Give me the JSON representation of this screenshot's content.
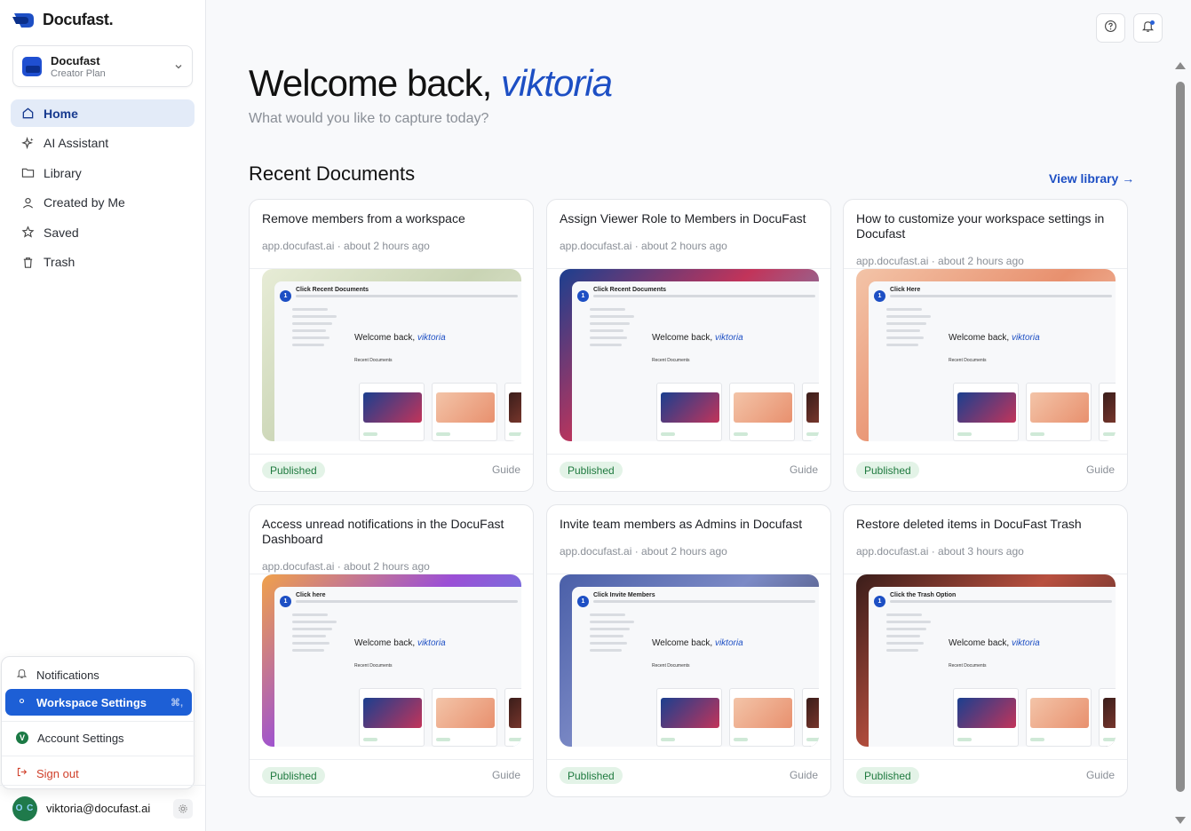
{
  "brand": {
    "name": "Docufast."
  },
  "workspace": {
    "name": "Docufast",
    "plan": "Creator Plan"
  },
  "nav": [
    {
      "label": "Home",
      "icon": "home-icon",
      "active": true
    },
    {
      "label": "AI Assistant",
      "icon": "sparkle-icon",
      "active": false
    },
    {
      "label": "Library",
      "icon": "folder-icon",
      "active": false
    },
    {
      "label": "Created by Me",
      "icon": "user-icon",
      "active": false
    },
    {
      "label": "Saved",
      "icon": "star-icon",
      "active": false
    },
    {
      "label": "Trash",
      "icon": "trash-icon",
      "active": false
    }
  ],
  "user_menu": {
    "notifications": "Notifications",
    "workspace_settings": "Workspace Settings",
    "workspace_settings_shortcut": "⌘,",
    "account_settings": "Account Settings",
    "account_initial": "V",
    "sign_out": "Sign out"
  },
  "user": {
    "email": "viktoria@docufast.ai",
    "avatar_text": "O C"
  },
  "main": {
    "welcome_prefix": "Welcome back, ",
    "welcome_name": "viktoria",
    "subtitle": "What would you like to capture today?",
    "section_title": "Recent Documents",
    "view_library": "View library →"
  },
  "documents": [
    {
      "title": "Remove members from a workspace",
      "meta": "app.docufast.ai · about 2 hours ago",
      "status": "Published",
      "type": "Guide",
      "thumb_step": "Click Recent Documents",
      "thumb_bg": "linear-gradient(135deg,#e7ecd6,#c9d4b4 50%,#e9eddc)"
    },
    {
      "title": "Assign Viewer Role to Members in DocuFast",
      "meta": "app.docufast.ai · about 2 hours ago",
      "status": "Published",
      "type": "Guide",
      "thumb_step": "Click Recent Documents",
      "thumb_bg": "linear-gradient(135deg,#1b3f8f,#c2345a 45%,#4cb6e8)"
    },
    {
      "title": "How to customize your workspace settings in Docufast",
      "meta": "app.docufast.ai · about 2 hours ago",
      "status": "Published",
      "type": "Guide",
      "thumb_step": "Click Here",
      "thumb_bg": "linear-gradient(135deg,#f3c4a8,#e8906e 50%,#f6d9c6)"
    },
    {
      "title": "Access unread notifications in the DocuFast Dashboard",
      "meta": "app.docufast.ai · about 2 hours ago",
      "status": "Published",
      "type": "Guide",
      "thumb_step": "Click here",
      "thumb_bg": "linear-gradient(135deg,#f0a14a,#9b4fd6 45%,#3aa6e6)"
    },
    {
      "title": "Invite team members as Admins in Docufast",
      "meta": "app.docufast.ai · about 2 hours ago",
      "status": "Published",
      "type": "Guide",
      "thumb_step": "Click Invite Members",
      "thumb_bg": "linear-gradient(135deg,#4a5fa8,#7c8ac6 45%,#2c2f47)"
    },
    {
      "title": "Restore deleted items in DocuFast Trash",
      "meta": "app.docufast.ai · about 3 hours ago",
      "status": "Published",
      "type": "Guide",
      "thumb_step": "Click the Trash Option",
      "thumb_bg": "linear-gradient(135deg,#3a1d1a,#b8503f 45%,#2a1a1f)"
    }
  ]
}
